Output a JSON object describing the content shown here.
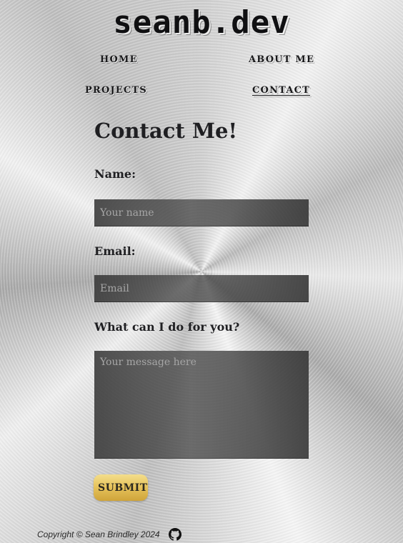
{
  "site": {
    "title": "seanb.dev"
  },
  "nav": {
    "items": [
      {
        "label": "HOME"
      },
      {
        "label": "ABOUT ME"
      },
      {
        "label": "PROJECTS"
      },
      {
        "label": "CONTACT",
        "active": true
      }
    ]
  },
  "page": {
    "heading": "Contact Me!"
  },
  "form": {
    "name": {
      "label": "Name:",
      "value": "",
      "placeholder": "Your name"
    },
    "email": {
      "label": "Email:",
      "value": "",
      "placeholder": "Email"
    },
    "message": {
      "label": "What can I do for you?",
      "value": "",
      "placeholder": "Your message here"
    },
    "submit_label": "SUBMIT"
  },
  "footer": {
    "copyright": "Copyright © Sean Brindley 2024",
    "github_icon": "github-icon"
  },
  "colors": {
    "submit_gold": "#e7c45d",
    "field_dark": "#4a4a4a",
    "text_dark": "#1f1f22"
  }
}
